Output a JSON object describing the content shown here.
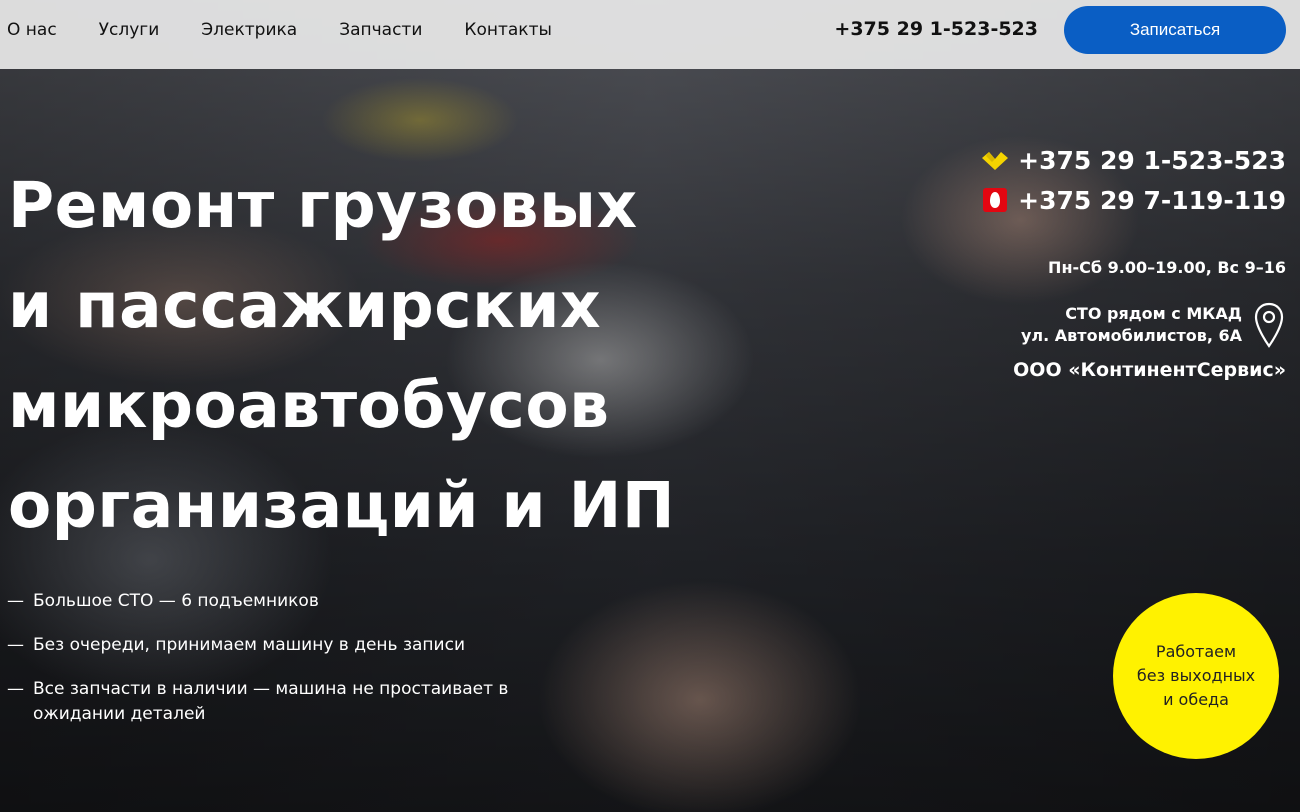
{
  "nav": {
    "items": [
      {
        "label": "О нас"
      },
      {
        "label": "Услуги"
      },
      {
        "label": "Электрика"
      },
      {
        "label": "Запчасти"
      },
      {
        "label": "Контакты"
      }
    ],
    "phone": "+375 29 1-523-523",
    "cta_label": "Записаться"
  },
  "hero": {
    "title_lines": [
      "Ремонт грузовых",
      "и пассажирских",
      "микроавтобусов",
      "организаций и ИП"
    ],
    "features": [
      {
        "dash": "—",
        "text": "Большое СТО — 6 подъемников"
      },
      {
        "dash": "—",
        "text": "Без очереди, принимаем машину в день записи"
      },
      {
        "dash": "—",
        "text": "Все запчасти в наличии — машина не простаивает в ожидании деталей"
      }
    ]
  },
  "contacts": {
    "phones": [
      {
        "number": "+375 29 1-523-523",
        "operator_icon": "velcom-icon",
        "color": "#f5d400"
      },
      {
        "number": "+375 29 7-119-119",
        "operator_icon": "mts-icon",
        "color": "#e30611"
      }
    ],
    "hours": "Пн-Сб 9.00–19.00, Вс 9–16",
    "address_line1": "СТО рядом с МКАД",
    "address_line2": "ул. Автомобилистов, 6А",
    "company": "ООО «КонтинентСервис»"
  },
  "badge": {
    "lines": [
      "Работаем",
      "без выходных",
      "и обеда"
    ],
    "color": "#fff200"
  },
  "colors": {
    "accent": "#0a5ec4",
    "badge": "#fff200",
    "topbar": "#e8e8e8"
  }
}
